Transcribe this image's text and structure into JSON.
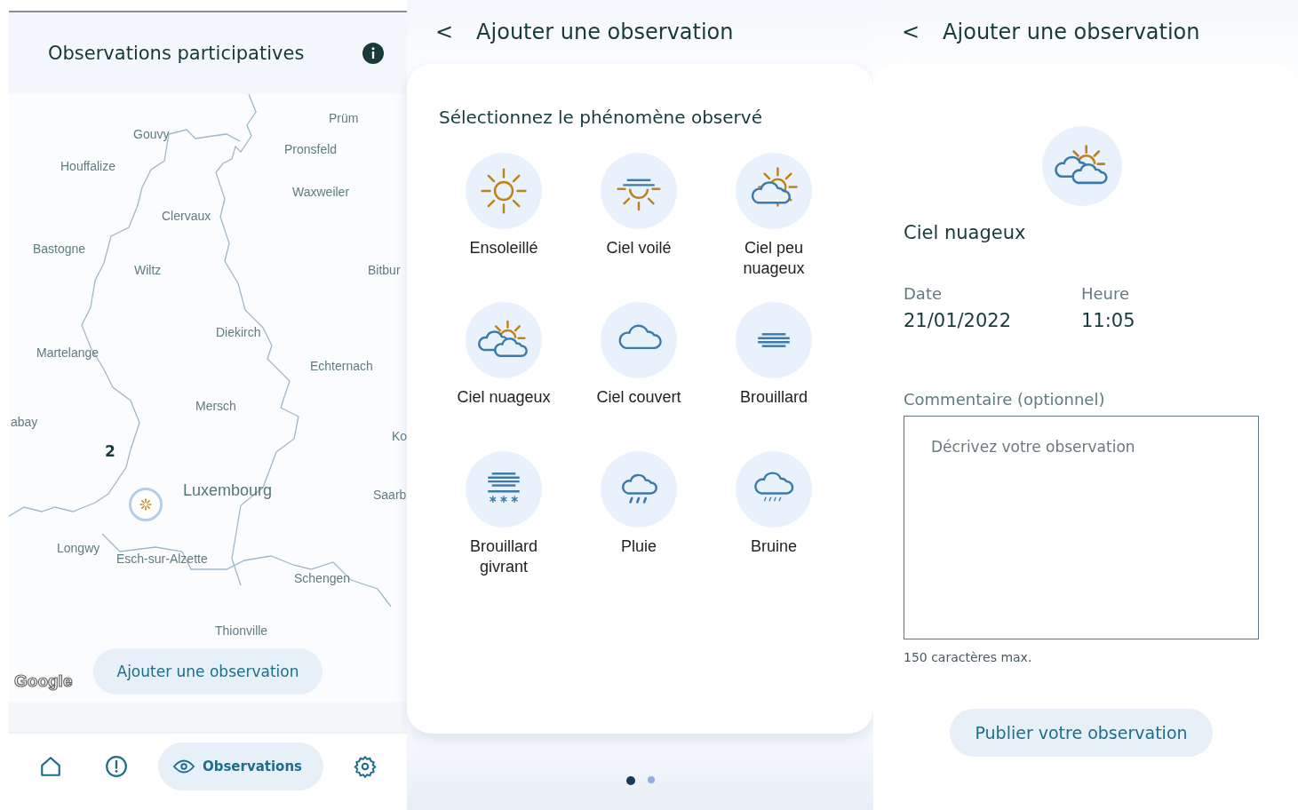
{
  "map_screen": {
    "title": "Observations participatives",
    "map_labels": [
      {
        "text": "Prüm",
        "kind": "town"
      },
      {
        "text": "Gouvy",
        "kind": "town"
      },
      {
        "text": "Pronsfeld",
        "kind": "town"
      },
      {
        "text": "Houffalize",
        "kind": "town"
      },
      {
        "text": "Waxweiler",
        "kind": "town"
      },
      {
        "text": "Clervaux",
        "kind": "town"
      },
      {
        "text": "Bastogne",
        "kind": "town"
      },
      {
        "text": "Wiltz",
        "kind": "town"
      },
      {
        "text": "Bitbur",
        "kind": "town"
      },
      {
        "text": "Diekirch",
        "kind": "town"
      },
      {
        "text": "Martelange",
        "kind": "town"
      },
      {
        "text": "Echternach",
        "kind": "town"
      },
      {
        "text": "Mersch",
        "kind": "town"
      },
      {
        "text": "abay",
        "kind": "town"
      },
      {
        "text": "Ko",
        "kind": "town"
      },
      {
        "text": "Luxembourg",
        "kind": "capital"
      },
      {
        "text": "Saarb",
        "kind": "town"
      },
      {
        "text": "Longwy",
        "kind": "town"
      },
      {
        "text": "Esch-sur-Alzette",
        "kind": "town"
      },
      {
        "text": "Schengen",
        "kind": "town"
      },
      {
        "text": "Thionville",
        "kind": "town"
      }
    ],
    "cluster_count": "2",
    "google_logo": "Google",
    "add_button": "Ajouter une observation",
    "nav": [
      {
        "kind": "home",
        "selected": false
      },
      {
        "kind": "alert",
        "selected": false
      },
      {
        "kind": "observations",
        "label": "Observations",
        "selected": true
      },
      {
        "kind": "settings",
        "selected": false
      }
    ]
  },
  "select_screen": {
    "back": "<",
    "title": "Ajouter une observation",
    "heading": "Sélectionnez le phénomène observé",
    "phenomena": [
      {
        "kind": "sunny",
        "label": "Ensoleillé"
      },
      {
        "kind": "veiled",
        "label": "Ciel voilé"
      },
      {
        "kind": "few-clouds",
        "label": "Ciel peu nuageux"
      },
      {
        "kind": "cloudy",
        "label": "Ciel nuageux"
      },
      {
        "kind": "overcast",
        "label": "Ciel couvert"
      },
      {
        "kind": "fog",
        "label": "Brouillard"
      },
      {
        "kind": "freezing-fog",
        "label": "Brouillard givrant"
      },
      {
        "kind": "rain",
        "label": "Pluie"
      },
      {
        "kind": "drizzle",
        "label": "Bruine"
      }
    ],
    "pager": [
      {
        "selected": true
      },
      {
        "selected": false
      }
    ]
  },
  "detail_screen": {
    "back": "<",
    "title": "Ajouter une observation",
    "phenomenon": {
      "kind": "cloudy",
      "label": "Ciel nuageux"
    },
    "date_label": "Date",
    "date": "21/01/2022",
    "time_label": "Heure",
    "time": "11:05",
    "comment_label": "Commentaire (optionnel)",
    "comment_placeholder": "Décrivez votre observation",
    "comment_hint": "150 caractères max.",
    "publish_button": "Publier votre observation"
  }
}
